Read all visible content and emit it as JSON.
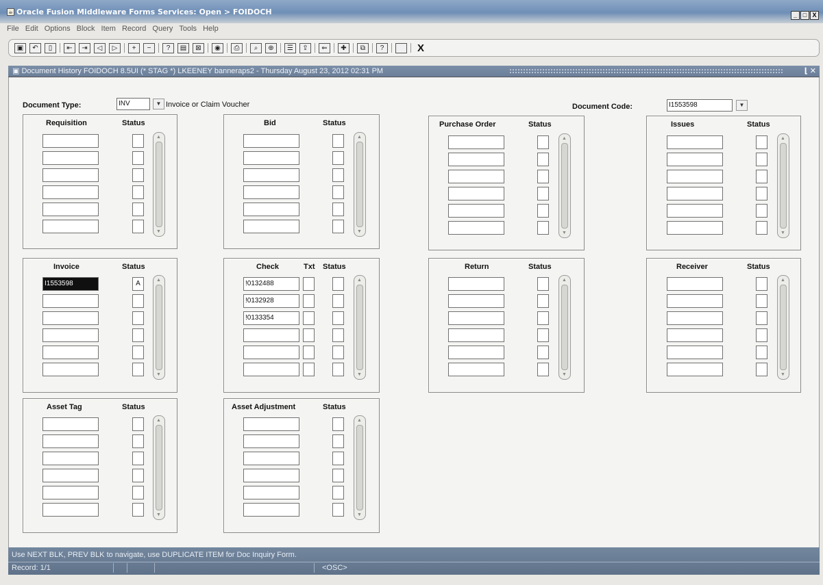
{
  "window": {
    "title": "Oracle Fusion Middleware Forms Services: Open > FOIDOCH",
    "icon": "java-cup-icon",
    "buttons": [
      "_",
      "□",
      "X"
    ]
  },
  "menu": [
    "File",
    "Edit",
    "Options",
    "Block",
    "Item",
    "Record",
    "Query",
    "Tools",
    "Help"
  ],
  "toolbar": {
    "icons": [
      "save-icon",
      "rollback-icon",
      "print-icon",
      "previous-block-icon",
      "next-block-icon",
      "previous-record-icon",
      "next-record-icon",
      "insert-record-icon",
      "remove-record-icon",
      "enter-query-icon",
      "execute-query-icon",
      "cancel-query-icon",
      "options-icon",
      "print-form-icon",
      "search-icon",
      "clear-icon",
      "menu-icon",
      "export-icon",
      "exit-icon",
      "help-icon",
      "blank-icon"
    ],
    "exit_label": "X"
  },
  "form_title": "Document History  FOIDOCH  8.5UI  (* STAG *)  LKEENEY  banneraps2 - Thursday August 23, 2012 02:31 PM",
  "key_block": {
    "doc_type_label": "Document Type:",
    "doc_type_value": "INV",
    "doc_type_desc": "Invoice or Claim Voucher",
    "doc_code_label": "Document Code:",
    "doc_code_value": "I1553598"
  },
  "blocks": {
    "requisition": {
      "title": "Requisition",
      "status_label": "Status",
      "rows": [
        "",
        "",
        "",
        "",
        "",
        ""
      ],
      "statuses": [
        "",
        "",
        "",
        "",
        "",
        ""
      ]
    },
    "bid": {
      "title": "Bid",
      "status_label": "Status",
      "rows": [
        "",
        "",
        "",
        "",
        "",
        ""
      ],
      "statuses": [
        "",
        "",
        "",
        "",
        "",
        ""
      ]
    },
    "purchase_order": {
      "title": "Purchase Order",
      "status_label": "Status",
      "rows": [
        "",
        "",
        "",
        "",
        "",
        ""
      ],
      "statuses": [
        "",
        "",
        "",
        "",
        "",
        ""
      ]
    },
    "issues": {
      "title": "Issues",
      "status_label": "Status",
      "rows": [
        "",
        "",
        "",
        "",
        "",
        ""
      ],
      "statuses": [
        "",
        "",
        "",
        "",
        "",
        ""
      ]
    },
    "invoice": {
      "title": "Invoice",
      "status_label": "Status",
      "rows": [
        "I1553598",
        "",
        "",
        "",
        "",
        ""
      ],
      "statuses": [
        "A",
        "",
        "",
        "",
        "",
        ""
      ]
    },
    "check": {
      "title": "Check",
      "txt_label": "Txt",
      "status_label": "Status",
      "rows": [
        "!0132488",
        "!0132928",
        "!0133354",
        "",
        "",
        ""
      ],
      "statuses": [
        "",
        "",
        "",
        "",
        "",
        ""
      ]
    },
    "return": {
      "title": "Return",
      "status_label": "Status",
      "rows": [
        "",
        "",
        "",
        "",
        "",
        ""
      ],
      "statuses": [
        "",
        "",
        "",
        "",
        "",
        ""
      ]
    },
    "receiver": {
      "title": "Receiver",
      "status_label": "Status",
      "rows": [
        "",
        "",
        "",
        "",
        "",
        ""
      ],
      "statuses": [
        "",
        "",
        "",
        "",
        "",
        ""
      ]
    },
    "asset_tag": {
      "title": "Asset Tag",
      "status_label": "Status",
      "rows": [
        "",
        "",
        "",
        "",
        "",
        ""
      ],
      "statuses": [
        "",
        "",
        "",
        "",
        "",
        ""
      ]
    },
    "asset_adjustment": {
      "title": "Asset Adjustment",
      "status_label": "Status",
      "rows": [
        "",
        "",
        "",
        "",
        "",
        ""
      ],
      "statuses": [
        "",
        "",
        "",
        "",
        "",
        ""
      ]
    }
  },
  "status_bar": {
    "message": "Use NEXT BLK, PREV BLK to navigate, use DUPLICATE ITEM for Doc Inquiry Form.",
    "record": "Record: 1/1",
    "osc": "<OSC>"
  },
  "colors": {
    "title_bar": "#7c96bb",
    "form_bar": "#75899f",
    "status_bar": "#6a7d94",
    "selected_field": "#101010"
  }
}
